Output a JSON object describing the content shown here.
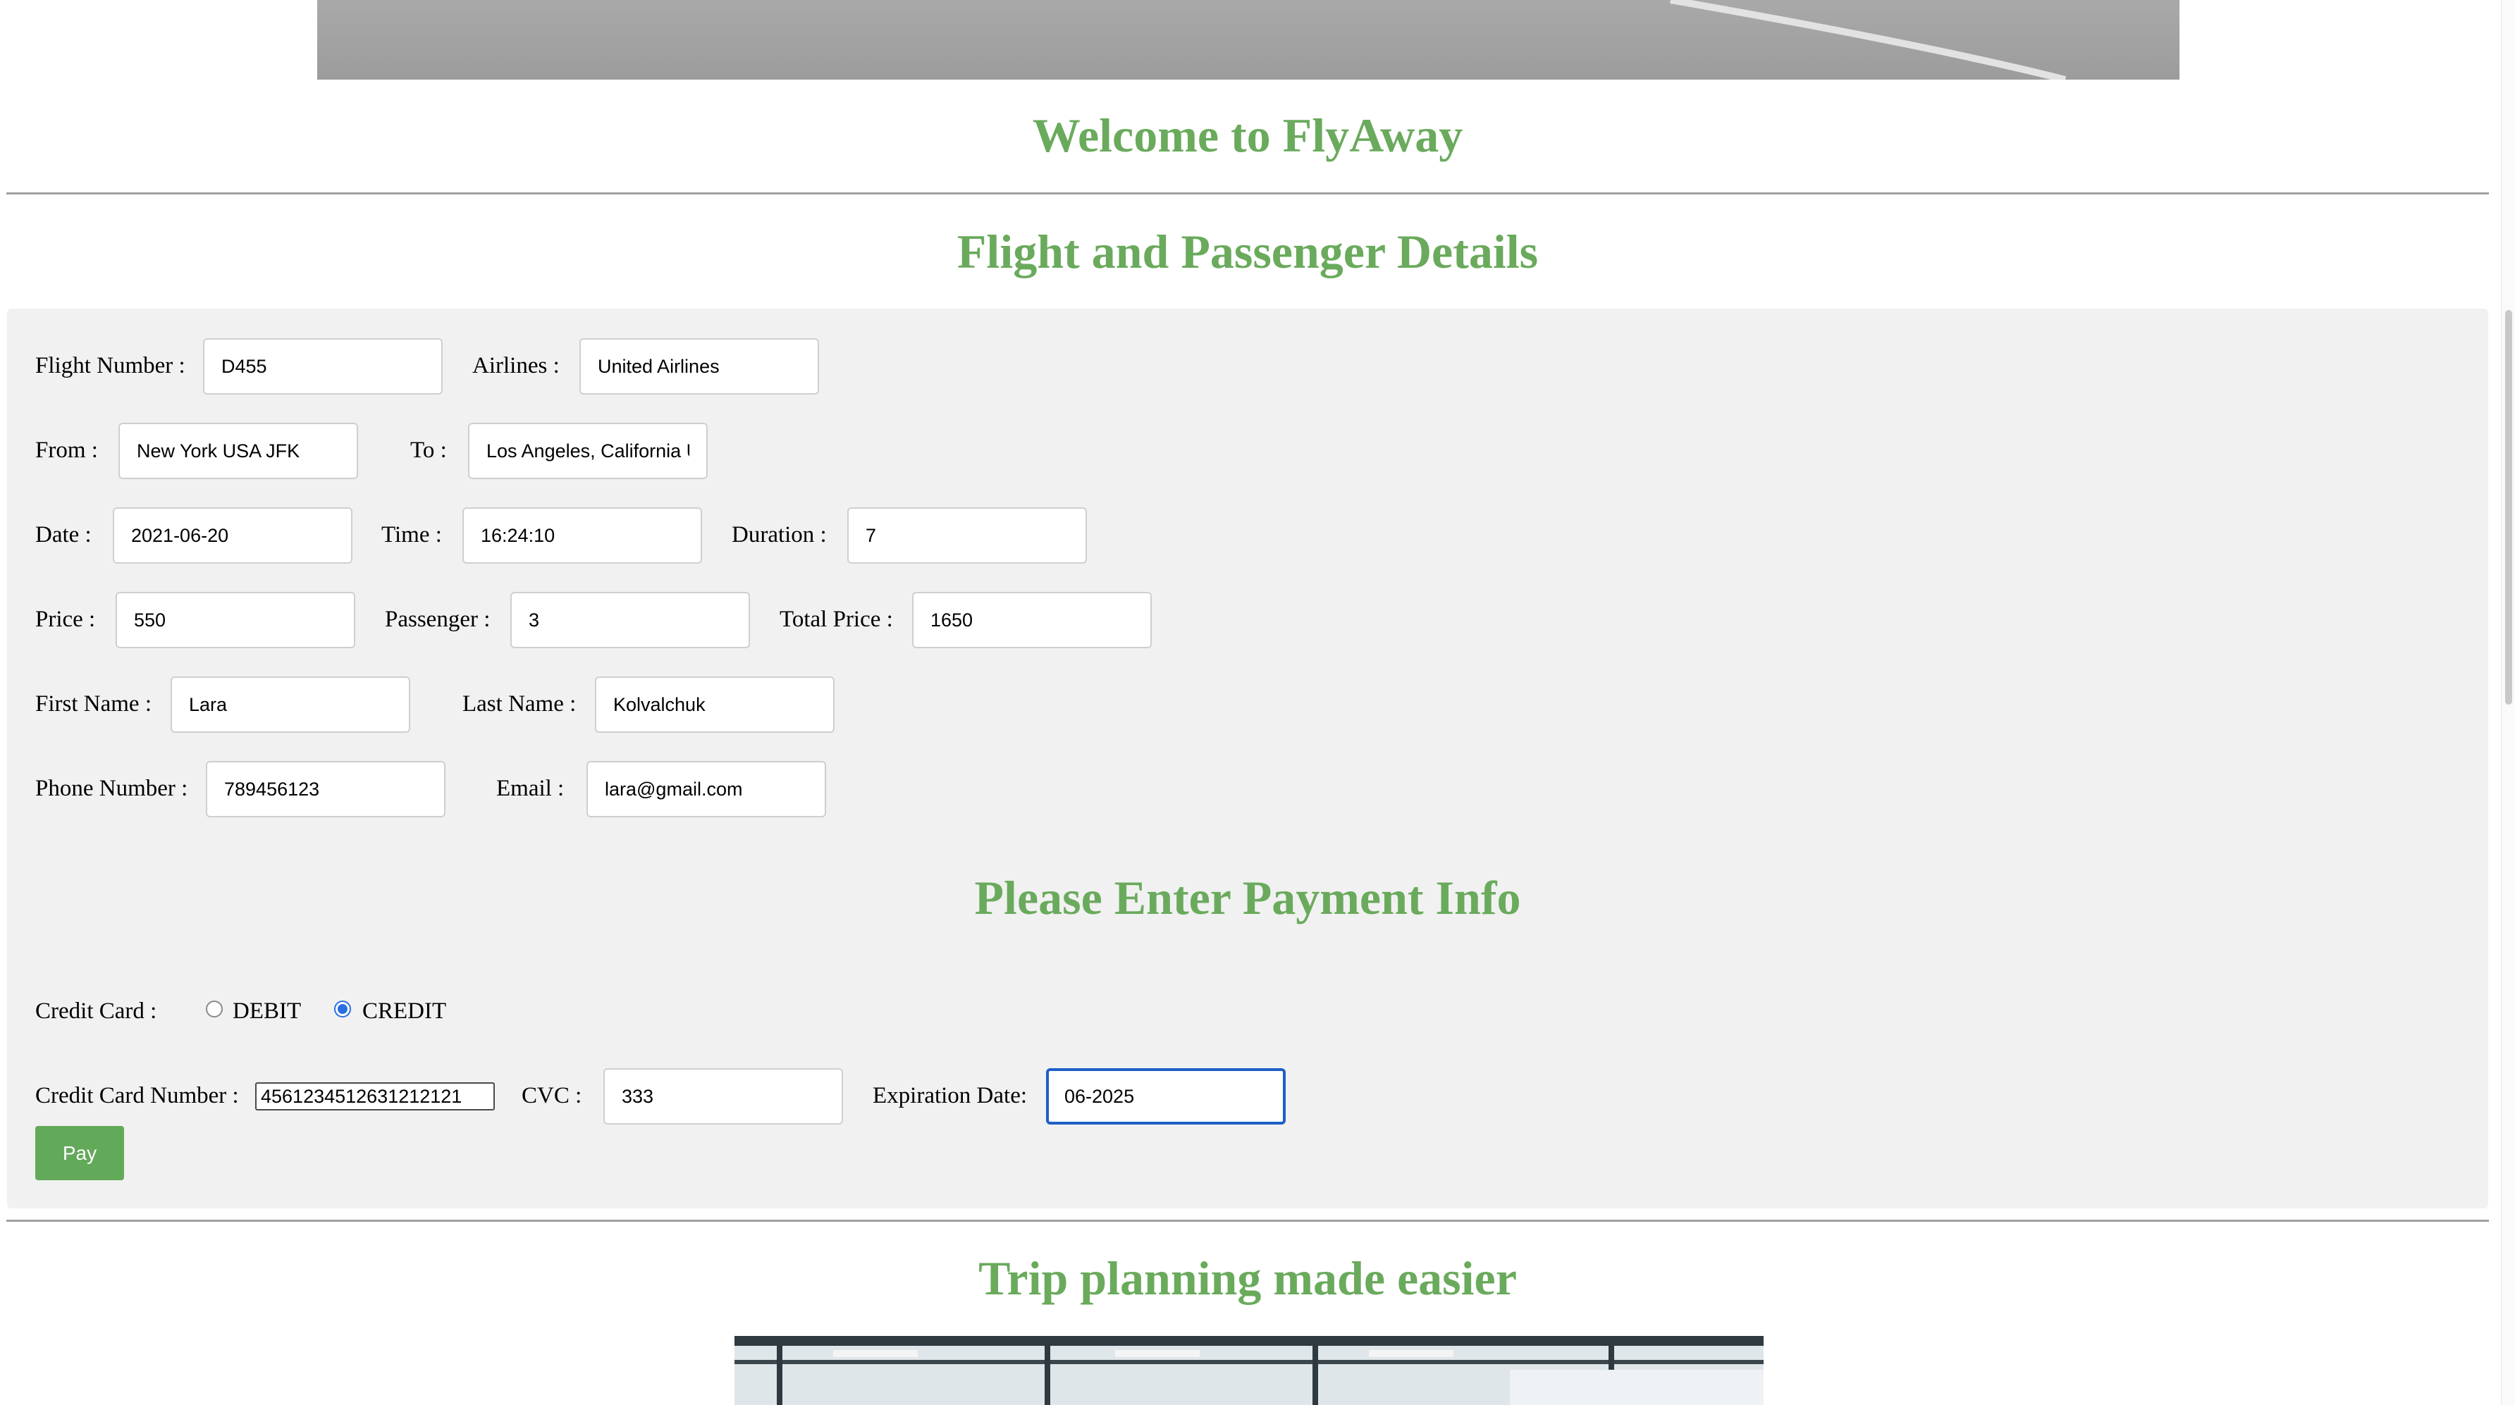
{
  "page": {
    "welcome_heading": "Welcome to FlyAway",
    "details_heading": "Flight and Passenger Details",
    "payment_heading": "Please Enter Payment Info",
    "footer_heading": "Trip planning made easier"
  },
  "flight": {
    "flight_number_label": "Flight Number :",
    "flight_number": "D455",
    "airlines_label": "Airlines :",
    "airlines": "United Airlines",
    "from_label": "From :",
    "from": "New York USA JFK",
    "to_label": "To :",
    "to": "Los Angeles, California U",
    "date_label": "Date :",
    "date": "2021-06-20",
    "time_label": "Time :",
    "time": "16:24:10",
    "duration_label": "Duration :",
    "duration": "7",
    "price_label": "Price :",
    "price": "550",
    "passenger_label": "Passenger :",
    "passenger": "3",
    "total_price_label": "Total Price :",
    "total_price": "1650"
  },
  "passenger": {
    "first_name_label": "First Name :",
    "first_name": "Lara",
    "last_name_label": "Last Name :",
    "last_name": "Kolvalchuk",
    "phone_label": "Phone Number :",
    "phone": "789456123",
    "email_label": "Email :",
    "email": "lara@gmail.com"
  },
  "payment": {
    "card_type_label": "Credit Card :",
    "debit_label": "DEBIT",
    "credit_label": "CREDIT",
    "selected_type": "CREDIT",
    "card_number_label": "Credit Card Number :",
    "card_number": "4561234512631212121",
    "cvc_label": "CVC :",
    "cvc": "333",
    "expiration_label": "Expiration Date:",
    "expiration": "06-2025",
    "pay_button": "Pay"
  },
  "colors": {
    "heading_green": "#6aaa5c",
    "button_green": "#62a95a",
    "panel_bg": "#f1f1f1",
    "focus_blue": "#1f5fc7"
  }
}
